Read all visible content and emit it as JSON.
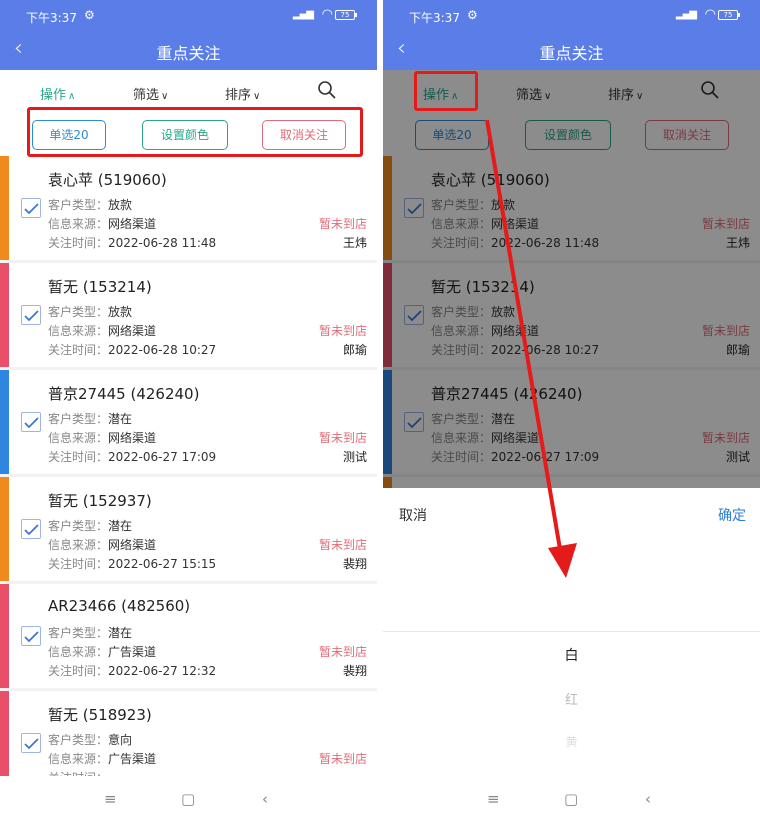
{
  "status_bar": {
    "time": "下午3:37",
    "battery": "75"
  },
  "header": {
    "title": "重点关注"
  },
  "tabs": {
    "operation": "操作",
    "filter": "筛选",
    "sort": "排序"
  },
  "actions": {
    "single_select": "单选20",
    "set_color": "设置颜色",
    "unfollow": "取消关注"
  },
  "labels": {
    "customer_type": "客户类型：",
    "info_source": "信息来源：",
    "follow_time": "关注时间："
  },
  "cards": [
    {
      "name": "袁心苹 (519060)",
      "type": "放款",
      "source": "网络渠道",
      "time": "2022-06-28 11:48",
      "status": "暂未到店",
      "person": "王炜",
      "stripe_color": "#f08a1c"
    },
    {
      "name": "暂无 (153214)",
      "type": "放款",
      "source": "网络渠道",
      "time": "2022-06-28 10:27",
      "status": "暂未到店",
      "person": "郎瑜",
      "stripe_color": "#e84f68"
    },
    {
      "name": "普京27445 (426240)",
      "type": "潜在",
      "source": "网络渠道",
      "time": "2022-06-27 17:09",
      "status": "暂未到店",
      "person": "测试",
      "stripe_color": "#2f86e0"
    },
    {
      "name": "暂无 (152937)",
      "type": "潜在",
      "source": "网络渠道",
      "time": "2022-06-27 15:15",
      "status": "暂未到店",
      "person": "裴翔",
      "stripe_color": "#f08a1c"
    },
    {
      "name": "AR23466 (482560)",
      "type": "潜在",
      "source": "广告渠道",
      "time": "2022-06-27 12:32",
      "status": "暂未到店",
      "person": "裴翔",
      "stripe_color": "#e84f68"
    },
    {
      "name": "暂无 (518923)",
      "type": "意向",
      "source": "广告渠道",
      "time": "",
      "status": "暂未到店",
      "person": "",
      "stripe_color": "#e84f68"
    }
  ],
  "picker": {
    "cancel": "取消",
    "confirm": "确定",
    "options": [
      "白",
      "红",
      "黄"
    ]
  },
  "icons": {
    "back": "chevron-left-icon",
    "search": "search-icon",
    "check": "check-icon",
    "nav_menu": "menu-icon",
    "nav_home": "home-icon",
    "nav_back": "back-icon"
  },
  "colors": {
    "header": "#5b7de8",
    "accent_green": "#2aa58a",
    "accent_blue": "#2d8bd6",
    "accent_red": "#e06b79",
    "annotation_red": "#e51b1b"
  }
}
